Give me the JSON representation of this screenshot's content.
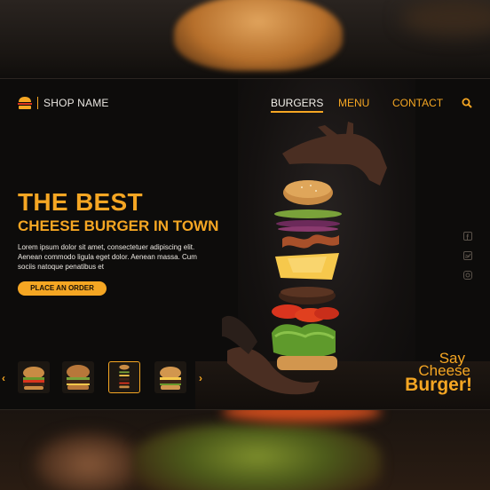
{
  "brand": {
    "name": "SHOP NAME",
    "icon": "burger-icon"
  },
  "nav": {
    "items": [
      {
        "label": "BURGERS",
        "active": true
      },
      {
        "label": "MENU",
        "active": false
      },
      {
        "label": "CONTACT",
        "active": false
      }
    ],
    "search_icon": "search-icon"
  },
  "hero": {
    "title": "THE BEST",
    "subtitle": "CHEESE BURGER IN TOWN",
    "body": "Lorem ipsum dolor sit amet, consectetuer adipiscing elit. Aenean commodo ligula eget dolor. Aenean massa. Cum sociis natoque penatibus et",
    "cta_label": "PLACE AN ORDER"
  },
  "social": [
    "facebook-icon",
    "twitter-icon",
    "instagram-icon"
  ],
  "carousel": {
    "prev_icon": "chevron-left-icon",
    "next_icon": "chevron-right-icon",
    "selected_index": 2,
    "count": 4
  },
  "tagline": {
    "line1": "Say",
    "line2": "Cheese",
    "line3": "Burger!"
  },
  "colors": {
    "accent": "#f5a623",
    "background": "#0d0c0b",
    "text": "#eeeae4"
  }
}
